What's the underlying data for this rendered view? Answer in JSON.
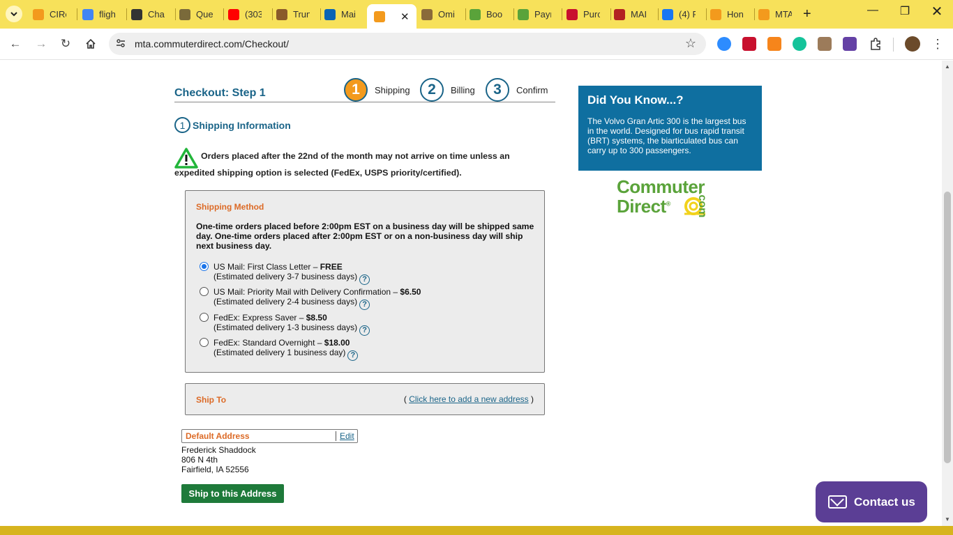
{
  "browser": {
    "tabs": [
      {
        "title": "CIRe",
        "color": "#f39a1d"
      },
      {
        "title": "fligh",
        "color": "#4285f4"
      },
      {
        "title": "Chat",
        "color": "#333333"
      },
      {
        "title": "Que",
        "color": "#7a6a3a"
      },
      {
        "title": "(303",
        "color": "#ff0000"
      },
      {
        "title": "Trun",
        "color": "#8a5a2a"
      },
      {
        "title": "Mai",
        "color": "#0a64b4"
      },
      {
        "title": "",
        "color": "#f39a1d"
      },
      {
        "title": "Omi",
        "color": "#8a6a3a"
      },
      {
        "title": "Boo",
        "color": "#5aa33a"
      },
      {
        "title": "Payr",
        "color": "#5aa33a"
      },
      {
        "title": "Purc",
        "color": "#c8102e"
      },
      {
        "title": "MAI",
        "color": "#b22222"
      },
      {
        "title": "(4) F",
        "color": "#1877f2"
      },
      {
        "title": "Hon",
        "color": "#f39a1d"
      },
      {
        "title": "MTA",
        "color": "#f39a1d"
      }
    ],
    "active_tab_index": 7,
    "url": "mta.commuterdirect.com/Checkout/",
    "new_tab_label": "+",
    "extensions": [
      {
        "name": "zm",
        "color": "#2d8cff"
      },
      {
        "name": "VM",
        "color": "#c8102e"
      },
      {
        "name": "metamask",
        "color": "#f6851b"
      },
      {
        "name": "grammarly",
        "color": "#15c39a"
      },
      {
        "name": "ext",
        "color": "#9c7b5a"
      },
      {
        "name": "twitch",
        "color": "#6441a5"
      }
    ]
  },
  "checkout": {
    "title": "Checkout: Step 1",
    "steps": [
      {
        "num": "1",
        "label": "Shipping"
      },
      {
        "num": "2",
        "label": "Billing"
      },
      {
        "num": "3",
        "label": "Confirm"
      }
    ],
    "section_num": "1",
    "section_title": "Shipping Information",
    "warning": "Orders placed after the 22nd of the month may not arrive on time unless an expedited shipping option is selected (FedEx, USPS priority/certified).",
    "shipping_method": {
      "heading": "Shipping Method",
      "description": "One-time orders placed before 2:00pm EST on a business day will be shipped same day. One-time orders placed after 2:00pm EST or on a non-business day will ship next business day.",
      "options": [
        {
          "name": "US Mail: First Class Letter",
          "price": "FREE",
          "estimate": "(Estimated delivery 3-7 business days)",
          "selected": true
        },
        {
          "name": "US Mail: Priority Mail with Delivery Confirmation",
          "price": "$6.50",
          "estimate": "(Estimated delivery 2-4 business days)",
          "selected": false
        },
        {
          "name": "FedEx: Express Saver",
          "price": "$8.50",
          "estimate": "(Estimated delivery 1-3 business days)",
          "selected": false
        },
        {
          "name": "FedEx: Standard Overnight",
          "price": "$18.00",
          "estimate": "(Estimated delivery 1 business day)",
          "selected": false
        }
      ]
    },
    "ship_to": {
      "heading": "Ship To",
      "link_open": "(",
      "link_text": "Click here to add a new address",
      "link_close": ")"
    },
    "address": {
      "heading": "Default Address",
      "edit": "Edit",
      "name": "Frederick Shaddock",
      "line1": "806 N 4th",
      "line2": "Fairfield, IA 52556"
    },
    "ship_button": "Ship to this Address"
  },
  "sidebar": {
    "did_you_know_title": "Did You Know...?",
    "did_you_know_body": "The Volvo Gran Artic 300 is the largest bus in the world. Designed for bus rapid transit (BRT) systems, the biarticulated bus can carry up to 300 passengers.",
    "logo_line1": "Commuter",
    "logo_line2": "Direct",
    "logo_suffix": ".com"
  },
  "contact": {
    "label": "Contact us"
  }
}
